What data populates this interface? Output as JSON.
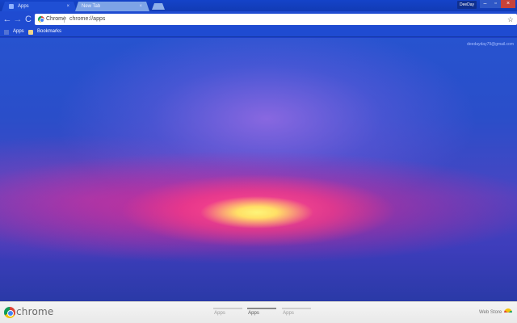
{
  "tabs": [
    {
      "title": "Apps",
      "close": "×",
      "active": true
    },
    {
      "title": "New Tab",
      "close": "×",
      "active": false
    }
  ],
  "profile": {
    "label": "DeeDay"
  },
  "window_controls": {
    "minimize": "–",
    "maximize": "▫",
    "close": "×"
  },
  "toolbar": {
    "back": "←",
    "forward": "→",
    "reload": "C",
    "scheme_label": "Chrome",
    "url": "chrome://apps",
    "star": "☆"
  },
  "bookmarks": {
    "apps_label": "Apps",
    "bookmarks_label": "Bookmarks"
  },
  "account": {
    "email": "deedayday79@gmail.com"
  },
  "bottombar": {
    "brand": "chrome",
    "pages": [
      {
        "label": "Apps",
        "active": false
      },
      {
        "label": "Apps",
        "active": true
      },
      {
        "label": "Apps",
        "active": false
      }
    ],
    "webstore_label": "Web Store"
  },
  "colors": {
    "frame": "#1f4bd1",
    "sky_top": "#2753cf",
    "sunset_pink": "#eb288c",
    "sun_yellow": "#fdf57a",
    "bottom_bar": "#f0f0f0"
  }
}
